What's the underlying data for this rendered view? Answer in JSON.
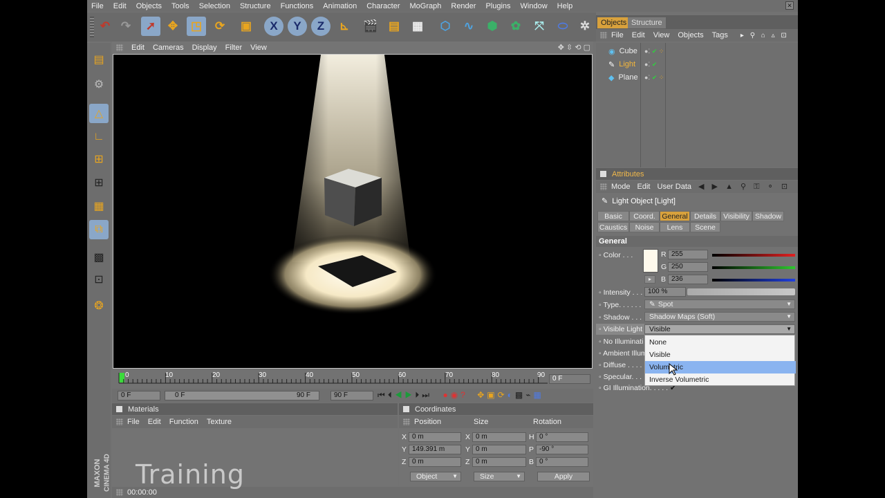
{
  "menubar": [
    "File",
    "Edit",
    "Objects",
    "Tools",
    "Selection",
    "Structure",
    "Functions",
    "Animation",
    "Character",
    "MoGraph",
    "Render",
    "Plugins",
    "Window",
    "Help"
  ],
  "toolbar": {
    "axis_x": "X",
    "axis_y": "Y",
    "axis_z": "Z"
  },
  "viewport": {
    "menu": [
      "Edit",
      "Cameras",
      "Display",
      "Filter",
      "View"
    ]
  },
  "timeline": {
    "ticks": [
      "0",
      "10",
      "20",
      "30",
      "40",
      "50",
      "60",
      "70",
      "80",
      "90"
    ],
    "current_frame": "0 F"
  },
  "playbar": {
    "start": "0 F",
    "range_start": "0 F",
    "range_end": "90 F",
    "end": "90 F"
  },
  "object_manager": {
    "tabs": [
      "Objects",
      "Structure"
    ],
    "menu": [
      "File",
      "Edit",
      "View",
      "Objects",
      "Tags"
    ],
    "objects": [
      {
        "name": "Cube"
      },
      {
        "name": "Light"
      },
      {
        "name": "Plane"
      }
    ]
  },
  "attributes": {
    "title": "Attributes",
    "menu": [
      "Mode",
      "Edit",
      "User Data"
    ],
    "object_label": "Light Object [Light]",
    "tabs_row1": [
      "Basic",
      "Coord.",
      "General",
      "Details",
      "Visibility",
      "Shadow"
    ],
    "tabs_row2": [
      "Caustics",
      "Noise",
      "Lens",
      "Scene"
    ],
    "active_tab": "General",
    "section": "General",
    "color_label": "Color . . .",
    "r_label": "R",
    "r": "255",
    "g_label": "G",
    "g": "250",
    "b_label": "B",
    "b": "236",
    "color_hex": "#fffaec",
    "intensity_label": "Intensity . . .",
    "intensity": "100 %",
    "type_label": "Type. . . . . .",
    "type": "Spot",
    "shadow_label": "Shadow . . .",
    "shadow": "Shadow Maps (Soft)",
    "visible_light_label": "Visible Light",
    "visible_light": "Visible",
    "no_illum_label": "No Illuminati",
    "ambient_label": "Ambient Illum",
    "diffuse_label": "Diffuse . . . .",
    "specular_label": "Specular. . .",
    "gi_label": "GI Illumination. . . . .",
    "gi_check": "✔",
    "dropdown_options": [
      "None",
      "Visible",
      "Volumetric",
      "Inverse Volumetric"
    ],
    "hovered_option": "Volumetric"
  },
  "materials": {
    "title": "Materials",
    "menu": [
      "File",
      "Edit",
      "Function",
      "Texture"
    ]
  },
  "coordinates": {
    "title": "Coordinates",
    "headers": [
      "Position",
      "Size",
      "Rotation"
    ],
    "rows": [
      {
        "pl": "X",
        "pv": "0 m",
        "sl": "X",
        "sv": "0 m",
        "rl": "H",
        "rv": "0 °"
      },
      {
        "pl": "Y",
        "pv": "149.391 m",
        "sl": "Y",
        "sv": "0 m",
        "rl": "P",
        "rv": "-90 °"
      },
      {
        "pl": "Z",
        "pv": "0 m",
        "sl": "Z",
        "sv": "0 m",
        "rl": "B",
        "rv": "0 °"
      }
    ],
    "mode1": "Object",
    "mode2": "Size",
    "apply": "Apply"
  },
  "status": {
    "time": "00:00:00"
  },
  "watermark": {
    "brand_top": "MAXON",
    "brand_bottom": "CINEMA 4D",
    "text": "Training"
  },
  "colors": {
    "accent": "#d8a13c",
    "highlight": "#8ab4f0",
    "panel": "#727272"
  }
}
